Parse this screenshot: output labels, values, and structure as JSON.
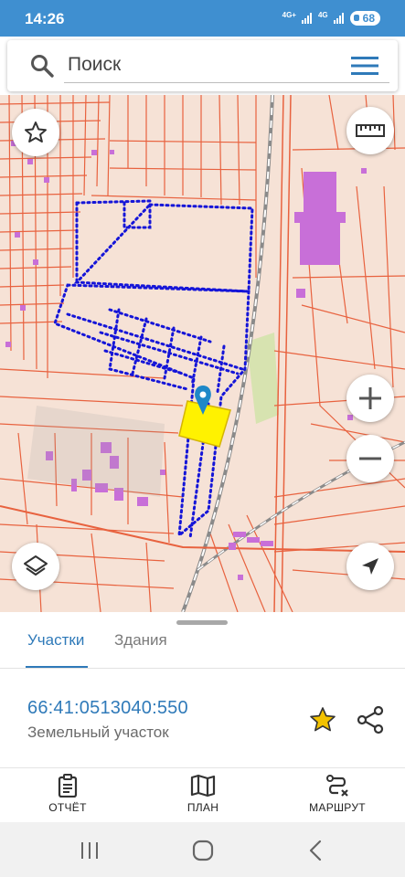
{
  "status_bar": {
    "time": "14:26",
    "network_1": "4G+",
    "network_2": "4G",
    "battery": "68"
  },
  "search": {
    "placeholder": "Поиск",
    "icon": "search-icon",
    "menu_icon": "hamburger-menu-icon"
  },
  "map": {
    "buttons": [
      "star-icon",
      "ruler-icon",
      "zoom-in-icon",
      "zoom-out-icon",
      "layers-icon",
      "navigation-arrow-icon"
    ],
    "colors": {
      "background": "#f6e2d6",
      "parcel_lines": "#e8623f",
      "buildings": "#c86fd8",
      "selected_parcel": "#fff200",
      "selection_border": "#1515d8",
      "marker": "#1e88c8",
      "green_area": "#cfe3a6"
    }
  },
  "sheet": {
    "tabs": [
      {
        "label": "Участки",
        "active": true
      },
      {
        "label": "Здания",
        "active": false
      }
    ],
    "parcel": {
      "cadastral_number": "66:41:0513040:550",
      "type": "Земельный участок",
      "favorite_color": "#f2c200"
    }
  },
  "bottom_nav": {
    "items": [
      {
        "label": "ОТЧЁТ",
        "icon": "clipboard-icon"
      },
      {
        "label": "ПЛАН",
        "icon": "map-plan-icon"
      },
      {
        "label": "МАРШРУТ",
        "icon": "route-icon"
      }
    ]
  },
  "system_nav": {
    "buttons": [
      "recents-icon",
      "home-icon",
      "back-icon"
    ]
  }
}
